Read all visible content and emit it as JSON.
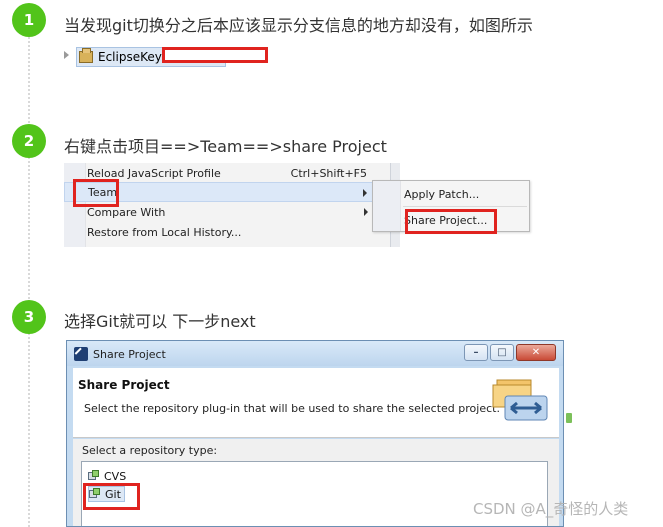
{
  "steps": [
    {
      "number": "1",
      "text": "当发现git切换分之后本应该显示分支信息的地方却没有，如图所示"
    },
    {
      "number": "2",
      "text": "右键点击项目==>Team==>share Project"
    },
    {
      "number": "3",
      "text": "选择Git就可以 下一步next"
    }
  ],
  "step1": {
    "project_label": "EclipseKey"
  },
  "context_menu": {
    "items": [
      {
        "label": "Reload JavaScript Profile",
        "accelerator": "Ctrl+Shift+F5"
      },
      {
        "label": "Team",
        "accelerator": ""
      },
      {
        "label": "Compare With",
        "accelerator": ""
      },
      {
        "label": "Restore from Local History...",
        "accelerator": ""
      }
    ],
    "submenu": [
      {
        "label": "Apply Patch..."
      },
      {
        "label": "Share Project..."
      }
    ]
  },
  "dialog": {
    "title": "Share Project",
    "heading": "Share Project",
    "description": "Select the repository plug-in that will be used to share the selected project.",
    "list_label": "Select a repository type:",
    "repository_types": [
      "CVS",
      "Git"
    ],
    "selected": "Git",
    "window_buttons": [
      "minimize",
      "maximize",
      "close"
    ]
  },
  "watermark": "CSDN @A_奇怪的人类",
  "colors": {
    "step_circle": "#52c41a",
    "highlight_box": "#e0231f"
  }
}
